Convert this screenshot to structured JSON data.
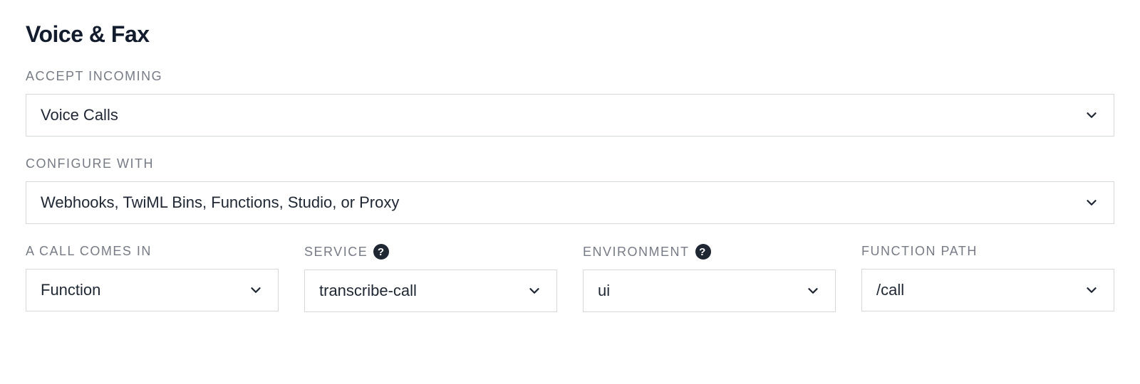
{
  "section": {
    "title": "Voice & Fax"
  },
  "fields": {
    "acceptIncoming": {
      "label": "ACCEPT INCOMING",
      "value": "Voice Calls"
    },
    "configureWith": {
      "label": "CONFIGURE WITH",
      "value": "Webhooks, TwiML Bins, Functions, Studio, or Proxy"
    },
    "aCallComesIn": {
      "label": "A CALL COMES IN",
      "value": "Function"
    },
    "service": {
      "label": "SERVICE",
      "value": "transcribe-call"
    },
    "environment": {
      "label": "ENVIRONMENT",
      "value": "ui"
    },
    "functionPath": {
      "label": "FUNCTION PATH",
      "value": "/call"
    }
  },
  "icons": {
    "help": "?"
  }
}
